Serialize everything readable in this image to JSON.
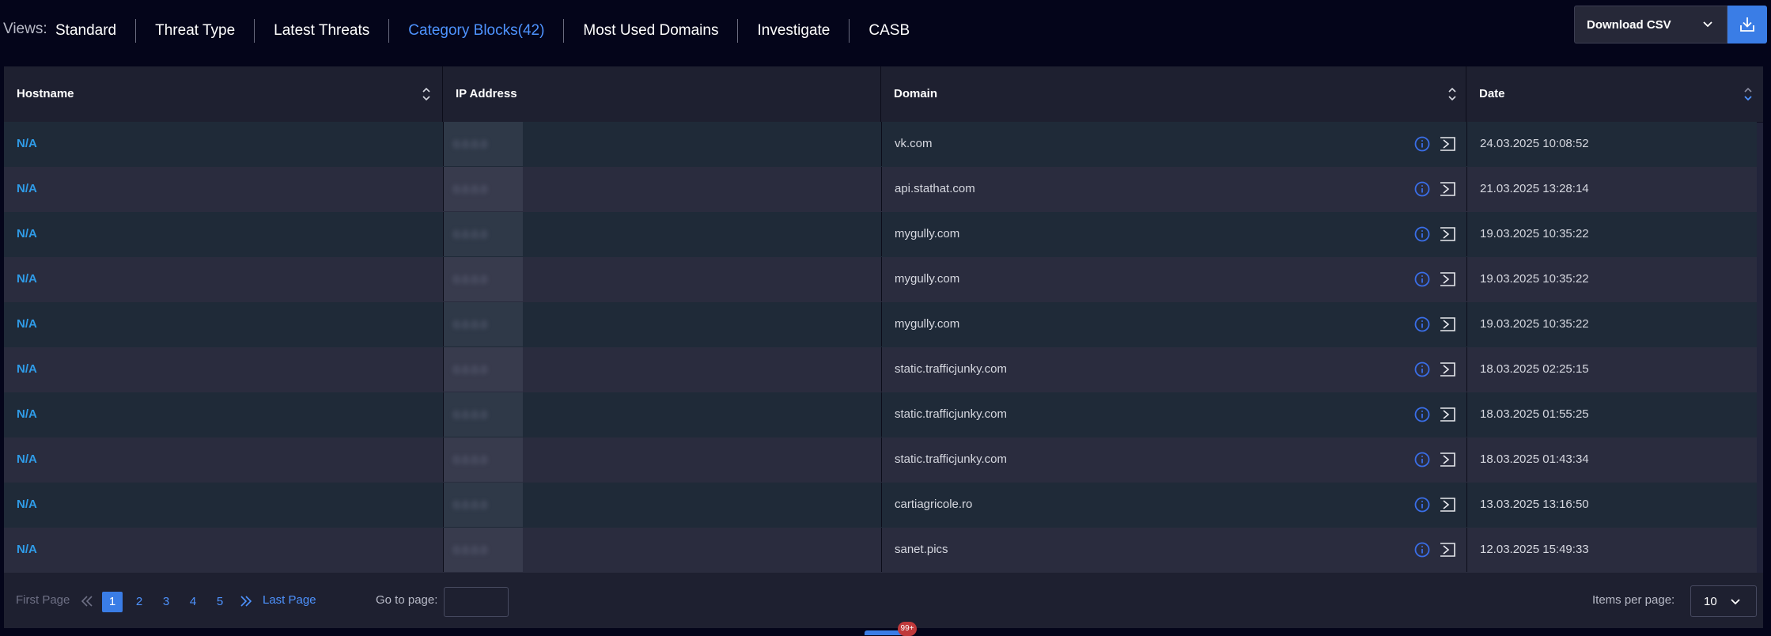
{
  "views": {
    "label": "Views:",
    "items": [
      {
        "label": "Standard",
        "active": false
      },
      {
        "label": "Threat Type",
        "active": false
      },
      {
        "label": "Latest Threats",
        "active": false
      },
      {
        "label": "Category Blocks(42)",
        "active": true
      },
      {
        "label": "Most Used Domains",
        "active": false
      },
      {
        "label": "Investigate",
        "active": false
      },
      {
        "label": "CASB",
        "active": false
      }
    ]
  },
  "download": {
    "label": "Download CSV",
    "icon": "download-icon"
  },
  "table": {
    "columns": [
      "Hostname",
      "IP Address",
      "Domain",
      "Date"
    ],
    "rows": [
      {
        "hostname": "N/A",
        "ip": "0.0.0.0",
        "domain": "vk.com",
        "date": "24.03.2025  10:08:52"
      },
      {
        "hostname": "N/A",
        "ip": "0.0.0.0",
        "domain": "api.stathat.com",
        "date": "21.03.2025  13:28:14"
      },
      {
        "hostname": "N/A",
        "ip": "0.0.0.0",
        "domain": "mygully.com",
        "date": "19.03.2025  10:35:22"
      },
      {
        "hostname": "N/A",
        "ip": "0.0.0.0",
        "domain": "mygully.com",
        "date": "19.03.2025  10:35:22"
      },
      {
        "hostname": "N/A",
        "ip": "0.0.0.0",
        "domain": "mygully.com",
        "date": "19.03.2025  10:35:22"
      },
      {
        "hostname": "N/A",
        "ip": "0.0.0.0",
        "domain": "static.trafficjunky.com",
        "date": "18.03.2025  02:25:15"
      },
      {
        "hostname": "N/A",
        "ip": "0.0.0.0",
        "domain": "static.trafficjunky.com",
        "date": "18.03.2025  01:55:25"
      },
      {
        "hostname": "N/A",
        "ip": "0.0.0.0",
        "domain": "static.trafficjunky.com",
        "date": "18.03.2025  01:43:34"
      },
      {
        "hostname": "N/A",
        "ip": "0.0.0.0",
        "domain": "cartiagricole.ro",
        "date": "13.03.2025  13:16:50"
      },
      {
        "hostname": "N/A",
        "ip": "0.0.0.0",
        "domain": "sanet.pics",
        "date": "12.03.2025  15:49:33"
      }
    ]
  },
  "pager": {
    "first_page": "First Page",
    "pages": [
      "1",
      "2",
      "3",
      "4",
      "5"
    ],
    "active_page": "1",
    "last_page": "Last Page",
    "goto_label": "Go to page:",
    "goto_value": "",
    "items_per_page_label": "Items per page:",
    "items_per_page": "10"
  },
  "notification_badge": "99+",
  "colors": {
    "background": "#04051a",
    "accent": "#4e93ff",
    "hostname_link": "#2f9ce8",
    "badge": "#c0393b"
  }
}
